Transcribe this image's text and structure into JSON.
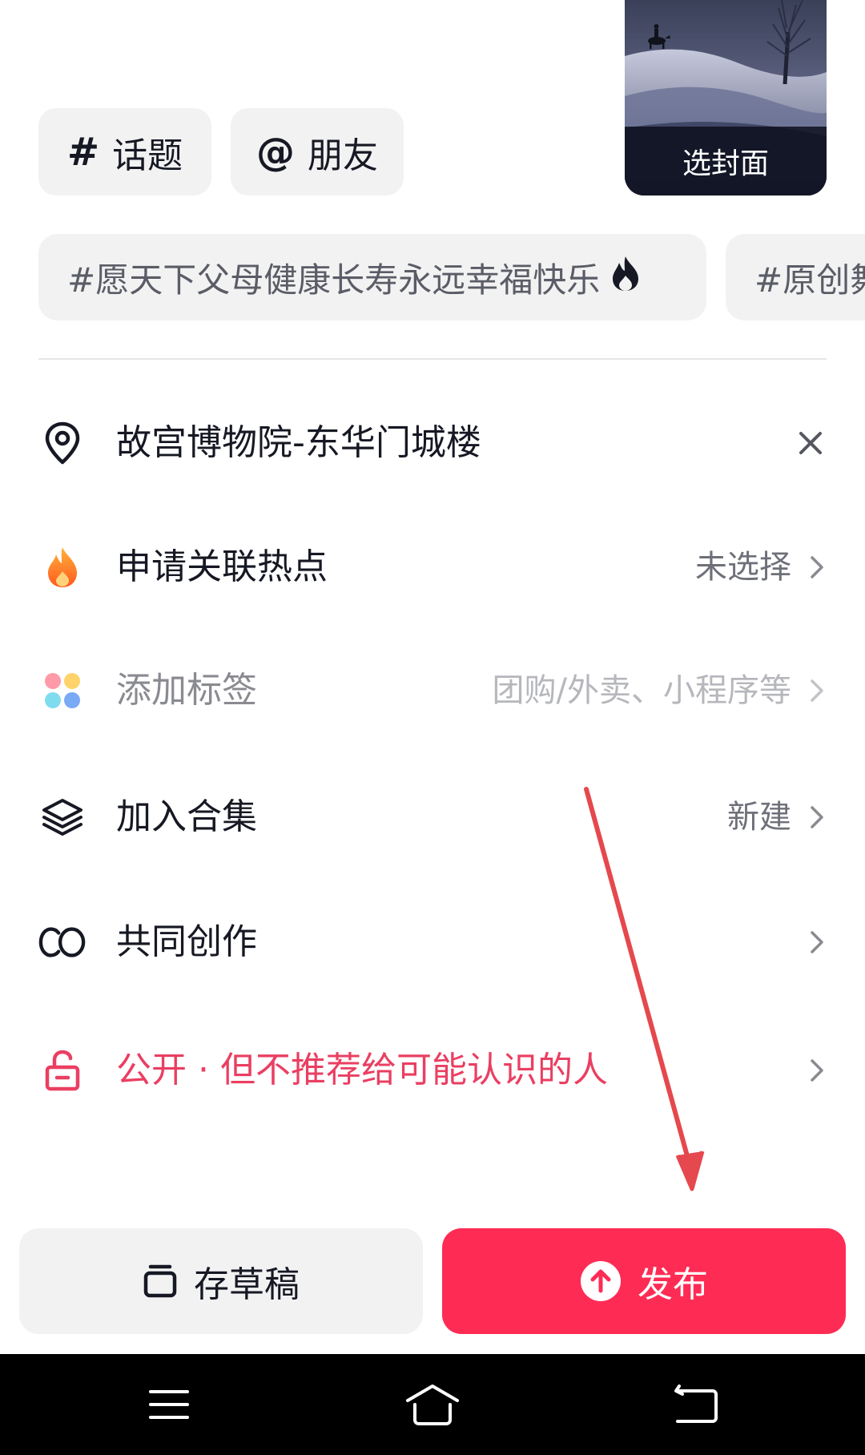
{
  "chips": {
    "topic": {
      "symbol": "#",
      "label": "话题"
    },
    "friend": {
      "symbol": "@",
      "label": "朋友"
    }
  },
  "cover": {
    "label": "选封面"
  },
  "suggested_tags": [
    {
      "text": "#愿天下父母健康长寿永远幸福快乐",
      "icon": "flame-icon"
    },
    {
      "text": "#原创舞"
    }
  ],
  "rows": {
    "location": {
      "icon": "location-pin-icon",
      "label": "故宫博物院-东华门城楼",
      "action_icon": "close-icon"
    },
    "hotspot": {
      "icon": "fire-icon",
      "label": "申请关联热点",
      "value": "未选择"
    },
    "tags": {
      "icon": "color-dots-icon",
      "label": "添加标签",
      "value": "团购/外卖、小程序等"
    },
    "collection": {
      "icon": "layers-icon",
      "label": "加入合集",
      "value": "新建"
    },
    "cocreate": {
      "icon": "co-icon",
      "label": "共同创作",
      "value": ""
    },
    "privacy": {
      "icon": "unlock-icon",
      "label": "公开 · 但不推荐给可能认识的人",
      "value": ""
    }
  },
  "buttons": {
    "draft": {
      "label": "存草稿",
      "icon": "draft-box-icon"
    },
    "publish": {
      "label": "发布",
      "icon": "upload-arrow-icon"
    }
  },
  "colors": {
    "accent": "#fe2c55",
    "privacy_text": "#ea3f62",
    "annotation_arrow": "#e5484d",
    "chip_bg": "#f2f2f3"
  },
  "system_nav": {
    "menu_icon": "menu-icon",
    "home_icon": "home-icon",
    "back_icon": "back-icon"
  }
}
